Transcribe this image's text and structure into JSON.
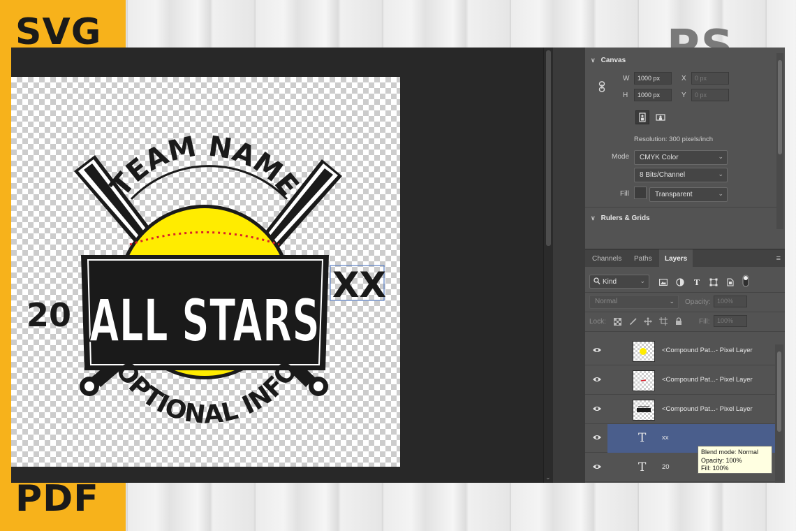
{
  "background": {
    "badge_top": "SVG",
    "badge_bottom": "PDF",
    "corner_mark": "PS",
    "accent_color": "#f7b21b"
  },
  "artwork": {
    "team_name": "TEAM NAME",
    "title": "ALL STARS",
    "year_prefix": "20",
    "year_suffix": "XX",
    "optional": "OPTIONAL INFO",
    "ball_color": "#ffec00",
    "stitch_color": "#d91f2a"
  },
  "properties": {
    "canvas_section": "Canvas",
    "w_label": "W",
    "w_value": "1000 px",
    "h_label": "H",
    "h_value": "1000 px",
    "x_label": "X",
    "x_value": "0 px",
    "y_label": "Y",
    "y_value": "0 px",
    "resolution": "Resolution: 300 pixels/inch",
    "mode_label": "Mode",
    "mode_value": "CMYK Color",
    "bits_value": "8 Bits/Channel",
    "fill_label": "Fill",
    "fill_value": "Transparent",
    "rulers_section": "Rulers & Grids"
  },
  "layers_panel": {
    "tabs": [
      "Channels",
      "Paths",
      "Layers"
    ],
    "active_tab": "Layers",
    "filter_kind": "Kind",
    "blend_mode": "Normal",
    "opacity_label": "Opacity:",
    "opacity_value": "100%",
    "lock_label": "Lock:",
    "fill_label": "Fill:",
    "fill_value": "100%",
    "layers": [
      {
        "name": "<Compound Pat...- Pixel Layer",
        "kind": "pixel",
        "thumb": "yellow"
      },
      {
        "name": "<Compound Pat...- Pixel Layer",
        "kind": "pixel",
        "thumb": "red"
      },
      {
        "name": "<Compound Pat...- Pixel Layer",
        "kind": "pixel",
        "thumb": "black"
      },
      {
        "name": "xx",
        "kind": "text",
        "selected": true
      },
      {
        "name": "20",
        "kind": "text"
      }
    ]
  },
  "tooltip": {
    "line1": "Blend mode: Normal",
    "line2": "Opacity: 100%",
    "line3": "Fill: 100%"
  }
}
